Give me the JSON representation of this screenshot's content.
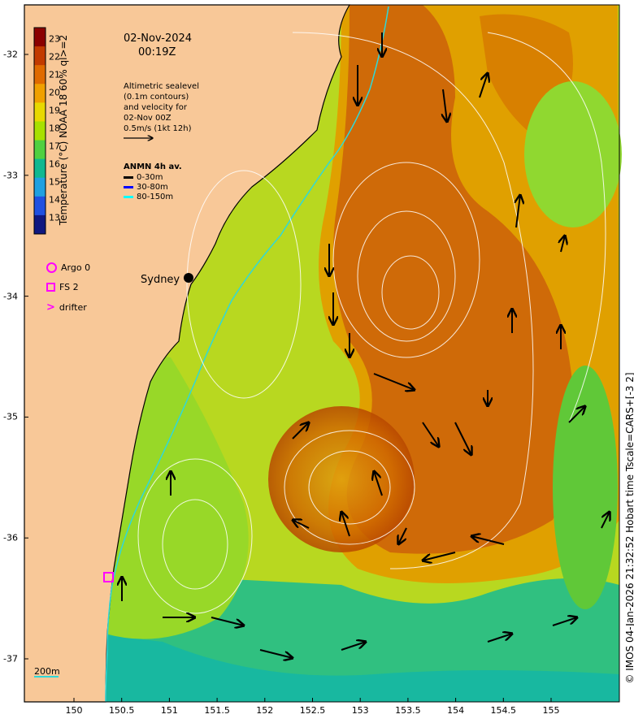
{
  "header": {
    "date": "02-Nov-2024",
    "time": "00:19Z"
  },
  "colorbar": {
    "title": "Temperature (°C) NOAA 18 60% ql>=2",
    "ticks": [
      "23",
      "22",
      "21",
      "20",
      "19",
      "18",
      "17",
      "16",
      "15",
      "14",
      "13"
    ],
    "colors": [
      "#8b0000",
      "#c23a00",
      "#e06a00",
      "#f0a000",
      "#e8d800",
      "#a8e000",
      "#50d040",
      "#10b890",
      "#20a0e0",
      "#2050e0",
      "#101880"
    ]
  },
  "altimetry_note": {
    "lines": [
      "Altimetric sealevel",
      "(0.1m contours)",
      "and velocity for",
      "02-Nov 00Z",
      "0.5m/s (1kt 12h)"
    ]
  },
  "anmn": {
    "title": "ANMN 4h av.",
    "items": [
      {
        "label": "0-30m",
        "color": "#000000"
      },
      {
        "label": "30-80m",
        "color": "#0000ff"
      },
      {
        "label": "80-150m",
        "color": "#00ffff"
      }
    ]
  },
  "legend": {
    "argo": "Argo 0",
    "fs": "FS 2",
    "drifter": "drifter"
  },
  "place_labels": {
    "sydney": "Sydney",
    "isobath": "200m"
  },
  "axes": {
    "x_ticks": [
      "150",
      "150.5",
      "151",
      "151.5",
      "152",
      "152.5",
      "153",
      "153.5",
      "154",
      "154.5",
      "155"
    ],
    "y_ticks": [
      "-32",
      "-33",
      "-34",
      "-35",
      "-36",
      "-37"
    ]
  },
  "credit": "© IMOS 04-Jan-2026 21:32:52 Hobart time Tscale=CARS+[-3 2]",
  "colors": {
    "land": "#f8c898",
    "coast": "#000000",
    "isobath": "#30d8d8",
    "marker": "#ff00ff",
    "contour": "#ffffff"
  }
}
